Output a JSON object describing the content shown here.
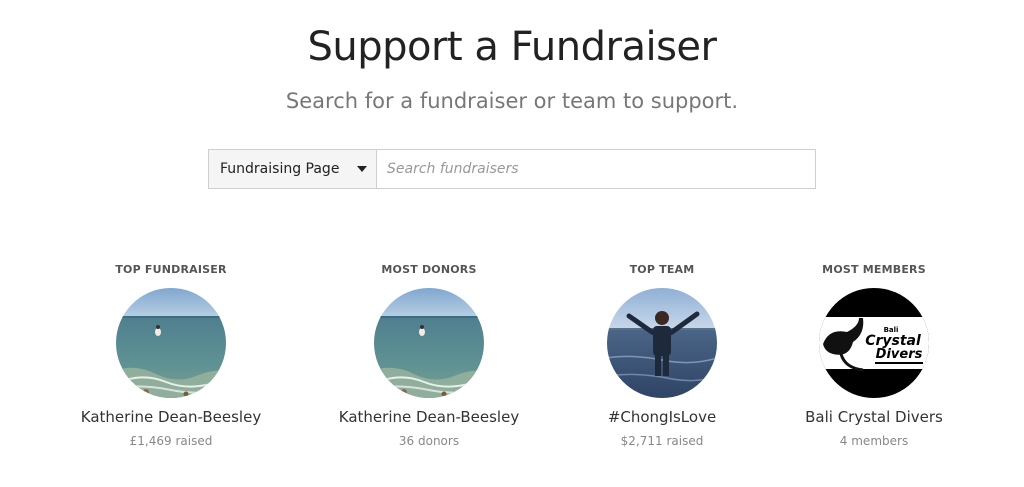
{
  "header": {
    "title": "Support a Fundraiser",
    "subtitle": "Search for a fundraiser or team to support."
  },
  "search": {
    "type_selected": "Fundraising Page",
    "placeholder": "Search fundraisers",
    "value": ""
  },
  "cards": [
    {
      "category": "TOP FUNDRAISER",
      "name": "Katherine Dean-Beesley",
      "stat": "£1,469 raised",
      "image": "sea-swimmer-photo"
    },
    {
      "category": "MOST DONORS",
      "name": "Katherine Dean-Beesley",
      "stat": "36 donors",
      "image": "sea-swimmer-photo"
    },
    {
      "category": "TOP TEAM",
      "name": "#ChongIsLove",
      "stat": "$2,711 raised",
      "image": "person-in-water-photo"
    },
    {
      "category": "MOST MEMBERS",
      "name": "Bali Crystal Divers",
      "stat": "4 members",
      "image": "bali-crystal-divers-logo"
    }
  ]
}
